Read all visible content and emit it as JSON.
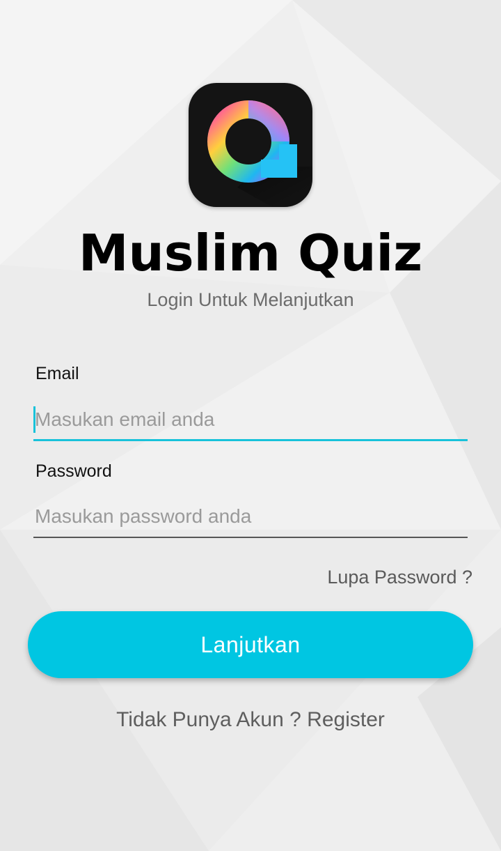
{
  "app": {
    "title": "Muslim Quiz",
    "subtitle": "Login Untuk Melanjutkan",
    "logo_icon": "q-rainbow-logo-icon"
  },
  "form": {
    "email": {
      "label": "Email",
      "placeholder": "Masukan email anda",
      "value": ""
    },
    "password": {
      "label": "Password",
      "placeholder": "Masukan password anda",
      "value": ""
    },
    "forgot_link": "Lupa Password ?",
    "submit_label": "Lanjutkan"
  },
  "footer": {
    "prompt": "Tidak Punya Akun ?",
    "register_link": "Register"
  },
  "colors": {
    "accent": "#00c6e2",
    "focus_line": "#18c2da",
    "title": "#000000",
    "muted_text": "#6b6b6b",
    "logo_background": "#141414"
  }
}
